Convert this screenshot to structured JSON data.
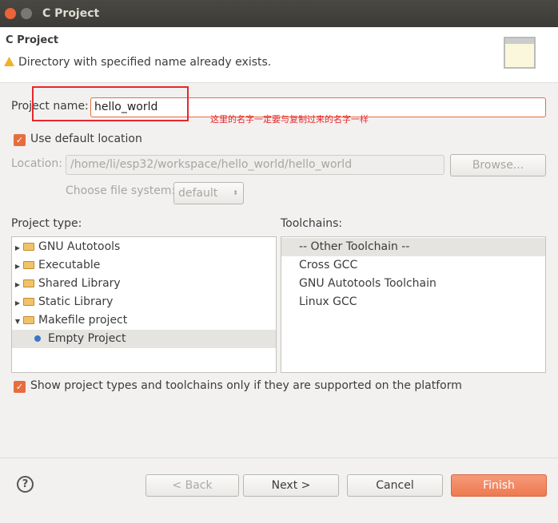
{
  "window": {
    "title": "C Project"
  },
  "header": {
    "title": "C Project",
    "message": "Directory with specified name already exists.",
    "warning_icon": "warning-icon"
  },
  "form": {
    "project_name_label": "Project name:",
    "project_name_value": "hello_world",
    "annotation": "这里的名字一定要与复制过来的名字一样",
    "annotation_color": "#e8262d",
    "use_default_location_label": "Use default location",
    "use_default_location_checked": true,
    "location_label": "Location:",
    "location_value": "/home/li/esp32/workspace/hello_world/hello_world",
    "browse_label": "Browse...",
    "file_system_label": "Choose file system:",
    "file_system_value": "default"
  },
  "project_types": {
    "label": "Project type:",
    "items": [
      {
        "label": "GNU Autotools",
        "expanded": false
      },
      {
        "label": "Executable",
        "expanded": false
      },
      {
        "label": "Shared Library",
        "expanded": false
      },
      {
        "label": "Static Library",
        "expanded": false
      },
      {
        "label": "Makefile project",
        "expanded": true
      },
      {
        "label": "Empty Project",
        "selected": true
      }
    ]
  },
  "toolchains": {
    "label": "Toolchains:",
    "items": [
      "-- Other Toolchain --",
      "Cross GCC",
      "GNU Autotools Toolchain",
      "Linux GCC"
    ]
  },
  "show_supported": {
    "label": "Show project types and toolchains only if they are supported on the platform",
    "checked": true
  },
  "buttons": {
    "back": "< Back",
    "next": "Next >",
    "cancel": "Cancel",
    "finish": "Finish",
    "accent": "#f0835c"
  }
}
